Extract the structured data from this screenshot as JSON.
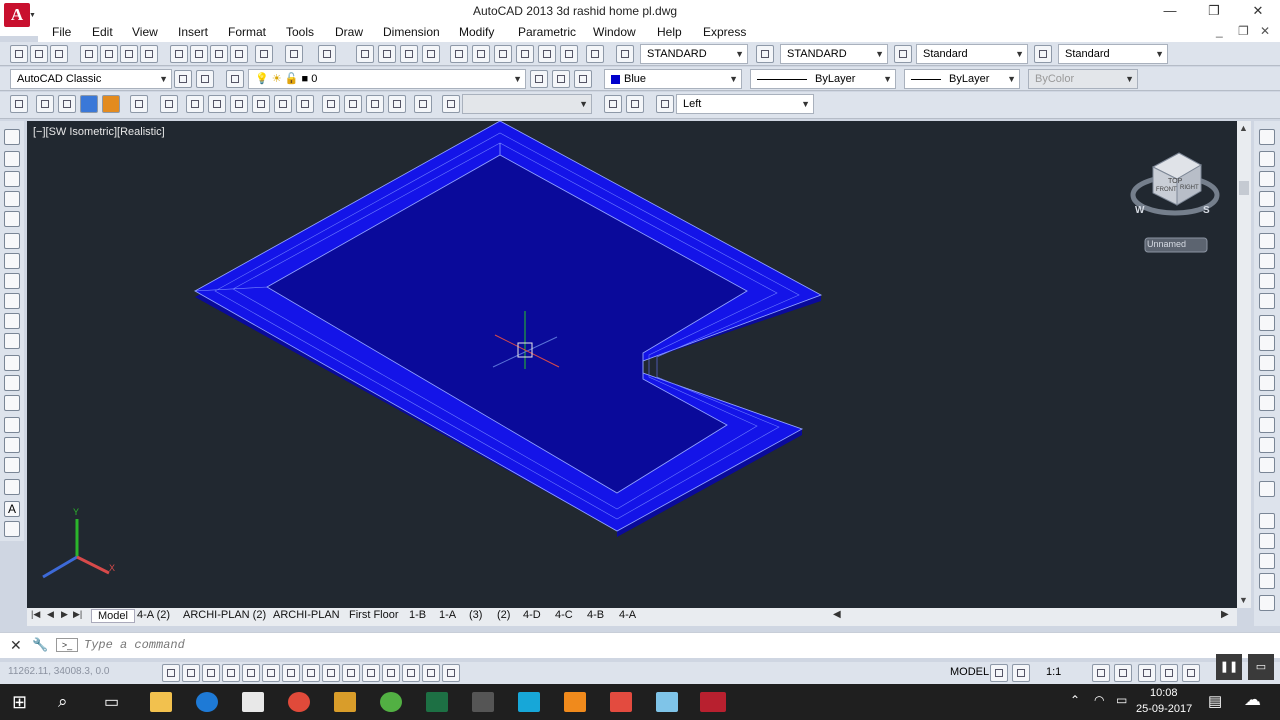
{
  "window": {
    "title": "AutoCAD 2013    3d rashid  home pl.dwg",
    "app_letter": "A",
    "min": "—",
    "restore": "❐",
    "close": "✕"
  },
  "menus": [
    "File",
    "Edit",
    "View",
    "Insert",
    "Format",
    "Tools",
    "Draw",
    "Dimension",
    "Modify",
    "Parametric",
    "Window",
    "Help",
    "Express"
  ],
  "toolbar": {
    "text_style": "STANDARD",
    "dim_style": "STANDARD",
    "table_style": "Standard",
    "mleader_style": "Standard",
    "workspace": "AutoCAD Classic",
    "layer": "0",
    "color": "Blue",
    "linetype": "ByLayer",
    "lineweight": "ByLayer",
    "plotstyle": "ByColor",
    "view": "Left"
  },
  "viewport": {
    "label": "[−][SW Isometric][Realistic]",
    "viewcube_named": "Unnamed",
    "viewcube_top": "TOP",
    "viewcube_front": "FRONT",
    "viewcube_right": "RIGHT",
    "compass_w": "W",
    "compass_s": "S",
    "ucs_x": "X",
    "ucs_y": "Y",
    "wall_color": "#1010e6",
    "bg_color": "#212830"
  },
  "layout_tabs": [
    "Model",
    "4-A (2)",
    "ARCHI-PLAN (2)",
    "ARCHI-PLAN",
    "First Floor",
    "1-B",
    "1-A",
    "(3)",
    "(2)",
    "4-D",
    "4-C",
    "4-B",
    "4-A"
  ],
  "command": {
    "placeholder": "Type a command"
  },
  "status": {
    "coords": "11262.11, 34008.3, 0.0",
    "model": "MODEL",
    "scale": "1:1"
  },
  "taskbar": {
    "time": "10:08",
    "date": "25-09-2017"
  }
}
